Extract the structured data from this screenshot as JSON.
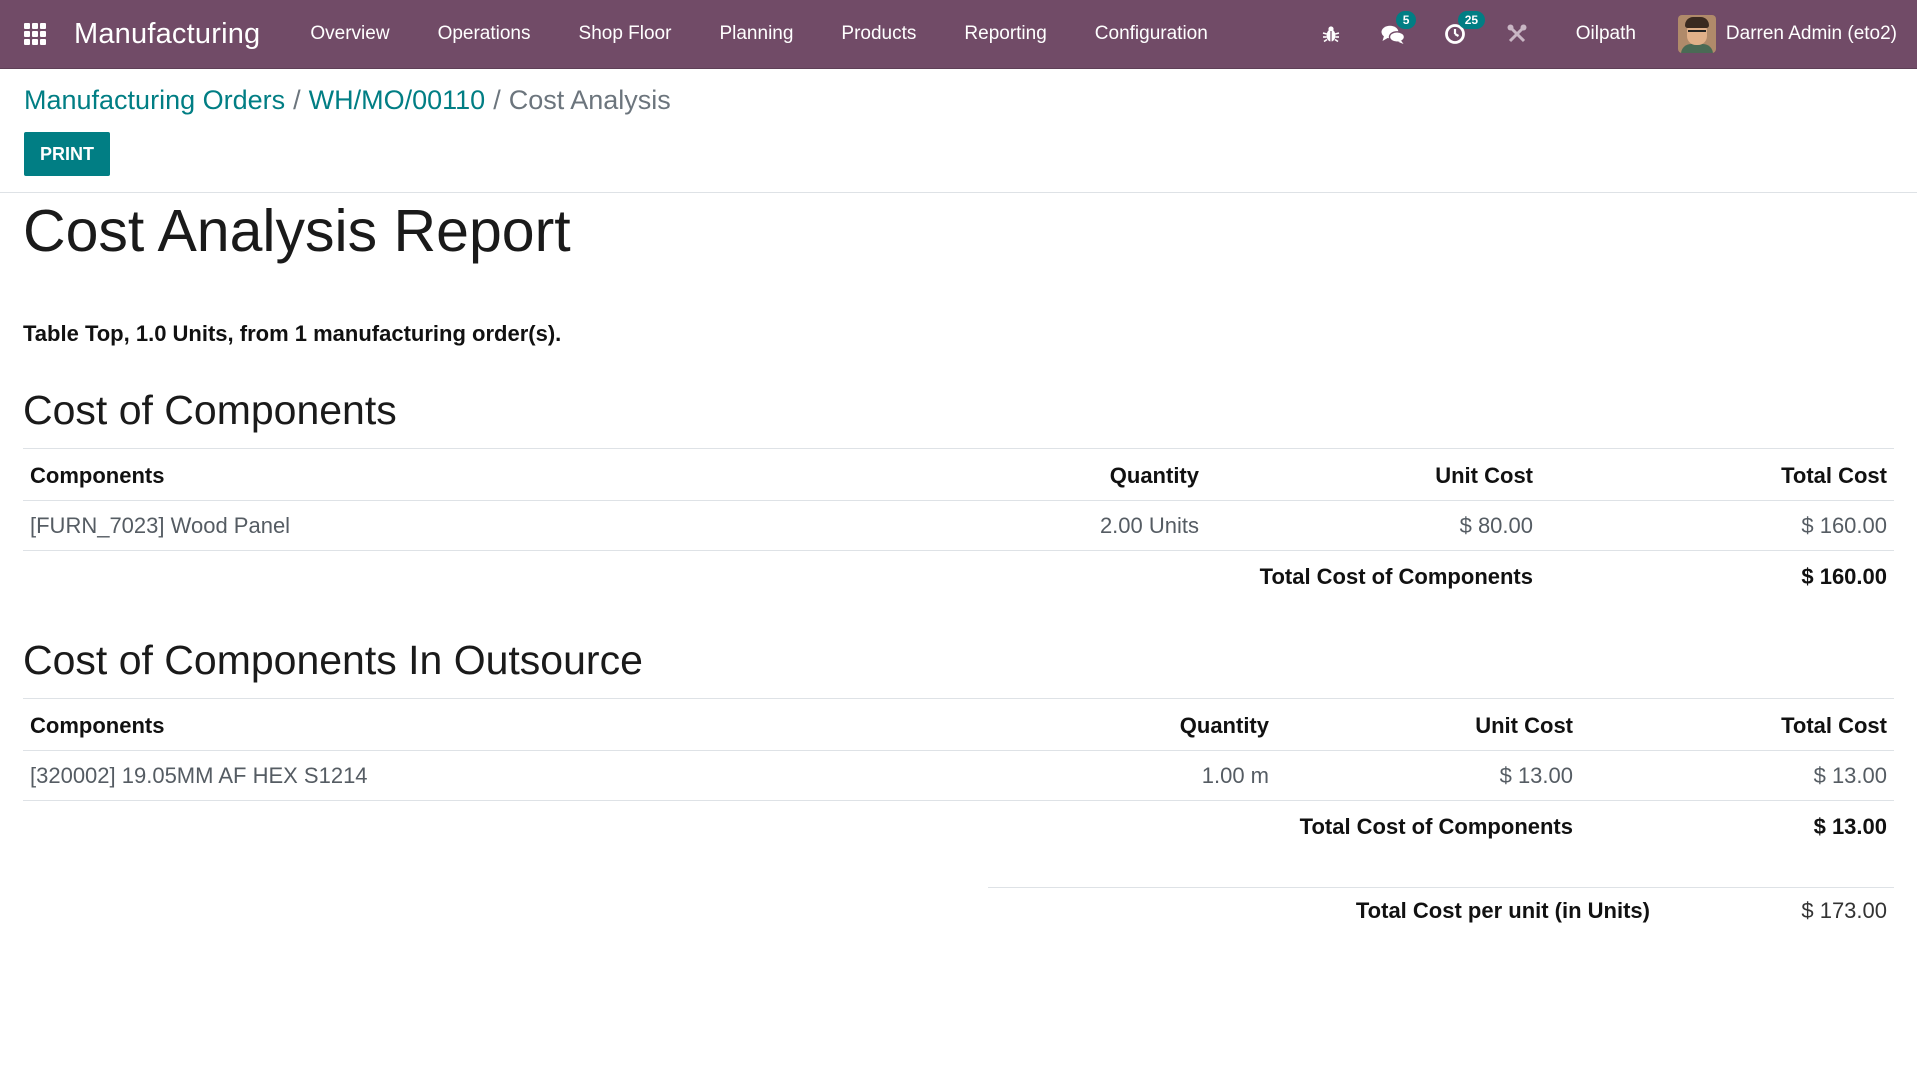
{
  "navbar": {
    "app_name": "Manufacturing",
    "menu": [
      "Overview",
      "Operations",
      "Shop Floor",
      "Planning",
      "Products",
      "Reporting",
      "Configuration"
    ],
    "messages_count": "5",
    "activities_count": "25",
    "company": "Oilpath",
    "user": "Darren Admin (eto2)",
    "icons": [
      "apps-grid-icon",
      "bug-icon",
      "chat-icon",
      "clock-icon",
      "tools-icon"
    ],
    "colors": {
      "navbar": "#714b67",
      "accent": "#017e84"
    }
  },
  "breadcrumb": {
    "items": [
      "Manufacturing Orders",
      "WH/MO/00110"
    ],
    "current": "Cost Analysis"
  },
  "actions": {
    "print_label": "PRINT"
  },
  "report": {
    "title": "Cost Analysis Report",
    "summary_product": "Table Top",
    "summary_rest": ", 1.0 Units, from 1 manufacturing order(s).",
    "sections": [
      {
        "title": "Cost of Components",
        "headers": [
          "Components",
          "Quantity",
          "Unit Cost",
          "Total Cost"
        ],
        "rows": [
          {
            "component": "[FURN_7023] Wood Panel",
            "quantity": "2.00 Units",
            "unit_cost": "$ 80.00",
            "total_cost": "$ 160.00"
          }
        ],
        "total_label": "Total Cost of Components",
        "total_value": "$ 160.00"
      },
      {
        "title": "Cost of Components In Outsource",
        "headers": [
          "Components",
          "Quantity",
          "Unit Cost",
          "Total Cost"
        ],
        "rows": [
          {
            "component": "[320002] 19.05MM AF HEX S1214",
            "quantity": "1.00 m",
            "unit_cost": "$ 13.00",
            "total_cost": "$ 13.00"
          }
        ],
        "total_label": "Total Cost of Components",
        "total_value": "$ 13.00"
      }
    ],
    "grand_total_label": "Total Cost per unit (in Units)",
    "grand_total_value": "$ 173.00"
  }
}
